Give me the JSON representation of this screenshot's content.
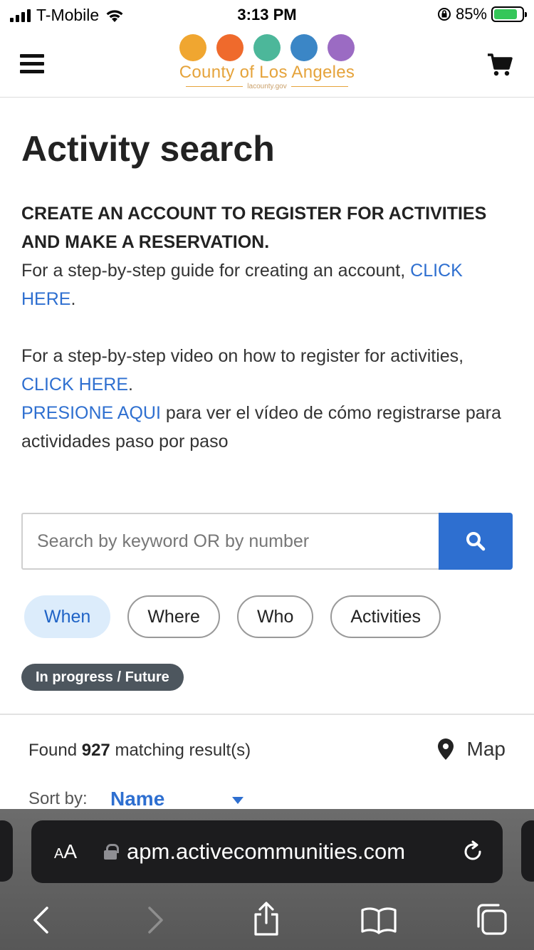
{
  "status_bar": {
    "carrier": "T-Mobile",
    "time": "3:13 PM",
    "battery": "85%",
    "battery_level": 0.85
  },
  "header": {
    "logo_text": "County of Los Angeles",
    "logo_site": "lacounty.gov",
    "logo_colors": [
      "#f0a630",
      "#ef6a2c",
      "#4cb79a",
      "#3b86c6",
      "#9b6bc3"
    ]
  },
  "page": {
    "title": "Activity search",
    "notice": "CREATE AN ACCOUNT TO REGISTER FOR ACTIVITIES AND MAKE A RESERVATION.",
    "guide_text": "For a step-by-step guide for creating an account,",
    "guide_link": "CLICK HERE",
    "video_text": "For a step-by-step video on how to register for activities,",
    "video_link": "CLICK HERE",
    "spanish_link": "PRESIONE AQUI",
    "spanish_text": "para ver el vídeo de cómo registrarse para actividades paso por paso",
    "period": "."
  },
  "search": {
    "placeholder": "Search by keyword OR by number",
    "value": ""
  },
  "filters": [
    {
      "label": "When",
      "active": true
    },
    {
      "label": "Where",
      "active": false
    },
    {
      "label": "Who",
      "active": false
    },
    {
      "label": "Activities",
      "active": false
    }
  ],
  "active_tag": "In progress / Future",
  "results": {
    "prefix": "Found",
    "count": "927",
    "suffix": "matching result(s)",
    "map_label": "Map",
    "sort_label": "Sort by:",
    "sort_value": "Name"
  },
  "browser": {
    "text_size_label_small": "A",
    "text_size_label_large": "A",
    "url": "apm.activecommunities.com"
  },
  "colors": {
    "link": "#2e6fd0",
    "search_button": "#2e6fd0",
    "active_pill_bg": "#dcecfb",
    "tag_bg": "#4d565e"
  }
}
